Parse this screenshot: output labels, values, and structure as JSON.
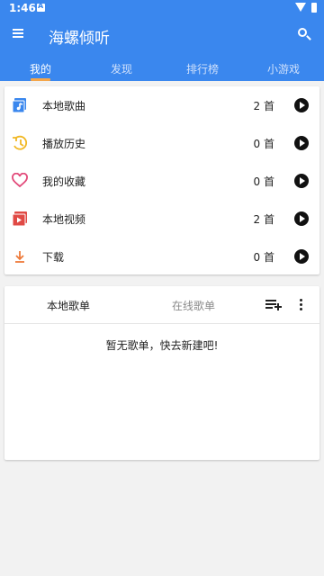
{
  "status_bar": {
    "time": "1:46"
  },
  "app": {
    "title": "海螺倾听"
  },
  "tabs": [
    {
      "label": "我的"
    },
    {
      "label": "发现"
    },
    {
      "label": "排行榜"
    },
    {
      "label": "小游戏"
    }
  ],
  "library": {
    "items": [
      {
        "label": "本地歌曲",
        "count": "2 首",
        "icon": "local-music-icon",
        "color": "#3a87ee"
      },
      {
        "label": "播放历史",
        "count": "0 首",
        "icon": "history-icon",
        "color": "#f1b824"
      },
      {
        "label": "我的收藏",
        "count": "0 首",
        "icon": "heart-icon",
        "color": "#e24a7a"
      },
      {
        "label": "本地视频",
        "count": "2 首",
        "icon": "video-icon",
        "color": "#e04a45"
      },
      {
        "label": "下载",
        "count": "0 首",
        "icon": "download-icon",
        "color": "#ee7a3a"
      }
    ]
  },
  "playlists": {
    "tab_local": "本地歌单",
    "tab_online": "在线歌单",
    "empty_text": "暂无歌单，快去新建吧!"
  },
  "colors": {
    "accent": "#3a87ee",
    "indicator": "#f4a64a"
  }
}
